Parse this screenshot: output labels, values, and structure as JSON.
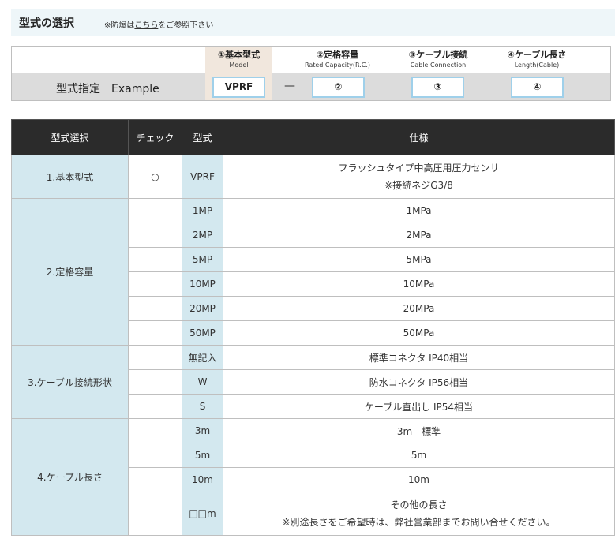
{
  "header": {
    "title": "型式の選択",
    "note_prefix": "※防爆は",
    "note_link": "こちら",
    "note_suffix": "をご参照下さい"
  },
  "model_spec": {
    "label": "型式指定　Example",
    "separator": "—",
    "columns": [
      {
        "title": "①基本型式",
        "sub": "Model",
        "code": "VPRF"
      },
      {
        "title": "②定格容量",
        "sub": "Rated Capacity(R.C.)",
        "code": "②"
      },
      {
        "title": "③ケーブル接続",
        "sub": "Cable Connection",
        "code": "③"
      },
      {
        "title": "④ケーブル長さ",
        "sub": "Length(Cable)",
        "code": "④"
      }
    ]
  },
  "table": {
    "headers": [
      "型式選択",
      "チェック",
      "型式",
      "仕様"
    ],
    "groups": [
      {
        "category": "1.基本型式",
        "rows": [
          {
            "check": "○",
            "code": "VPRF",
            "spec": "フラッシュタイプ中高圧用圧力センサ",
            "spec2": "※接続ネジG3/8"
          }
        ]
      },
      {
        "category": "2.定格容量",
        "rows": [
          {
            "check": "",
            "code": "1MP",
            "spec": "1MPa"
          },
          {
            "check": "",
            "code": "2MP",
            "spec": "2MPa"
          },
          {
            "check": "",
            "code": "5MP",
            "spec": "5MPa"
          },
          {
            "check": "",
            "code": "10MP",
            "spec": "10MPa"
          },
          {
            "check": "",
            "code": "20MP",
            "spec": "20MPa"
          },
          {
            "check": "",
            "code": "50MP",
            "spec": "50MPa"
          }
        ]
      },
      {
        "category": "3.ケーブル接続形状",
        "rows": [
          {
            "check": "",
            "code": "無記入",
            "spec": "標準コネクタ IP40相当"
          },
          {
            "check": "",
            "code": "W",
            "spec": "防水コネクタ IP56相当"
          },
          {
            "check": "",
            "code": "S",
            "spec": "ケーブル直出し IP54相当"
          }
        ]
      },
      {
        "category": "4.ケーブル長さ",
        "rows": [
          {
            "check": "",
            "code": "3m",
            "spec": "3m　標準"
          },
          {
            "check": "",
            "code": "5m",
            "spec": "5m"
          },
          {
            "check": "",
            "code": "10m",
            "spec": "10m"
          },
          {
            "check": "",
            "code": "□□m",
            "spec": "その他の長さ",
            "spec2": "※別途長さをご希望時は、弊社営業部までお問い合せください。"
          }
        ]
      }
    ]
  }
}
